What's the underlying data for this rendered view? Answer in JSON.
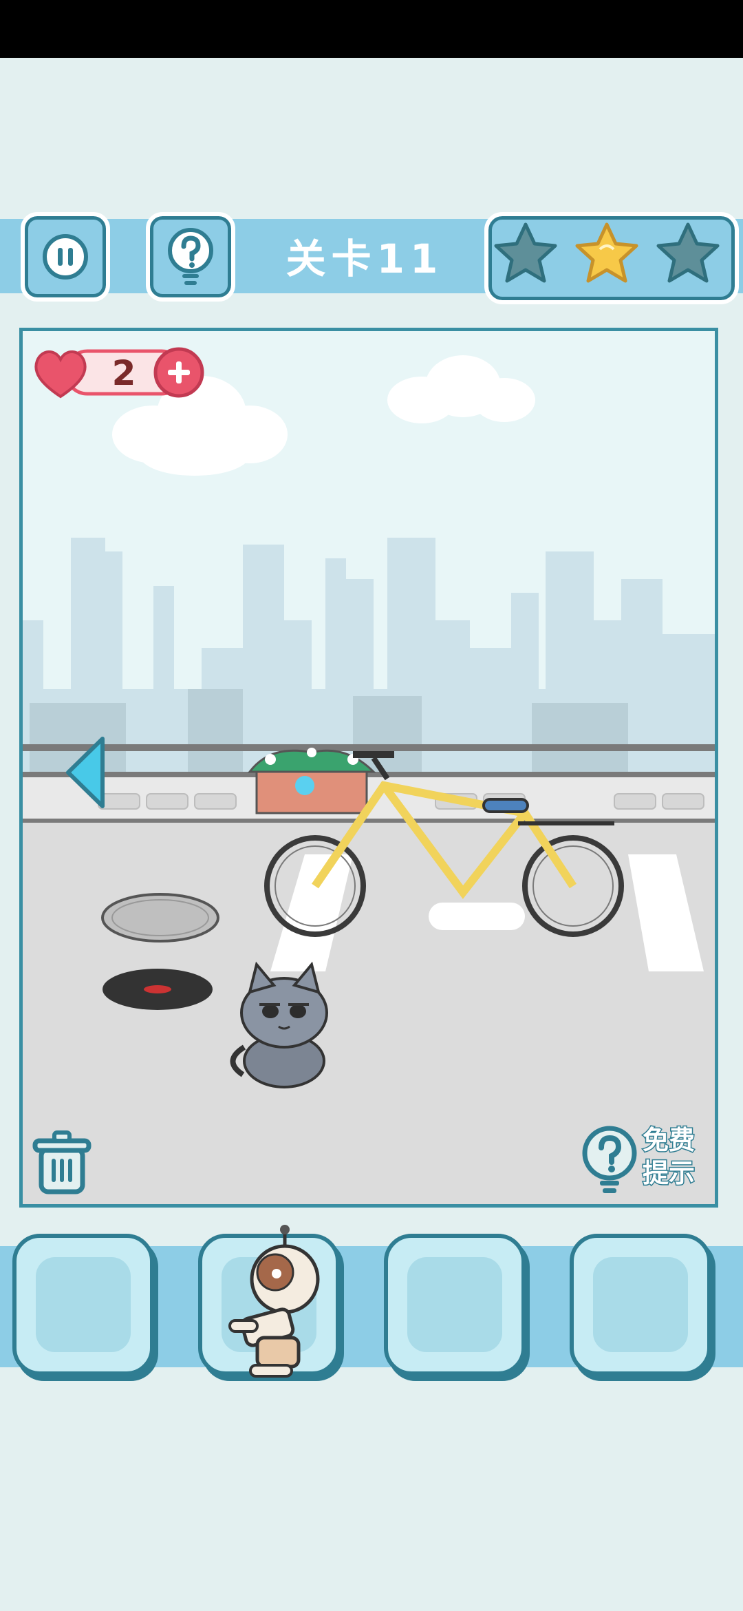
{
  "header": {
    "level_title": "关卡11",
    "stars": [
      {
        "name": "star-1",
        "earned": false
      },
      {
        "name": "star-2",
        "earned": true
      },
      {
        "name": "star-3",
        "earned": false
      }
    ],
    "pause_icon": "pause-icon",
    "help_icon": "question-bulb-icon"
  },
  "game": {
    "lives_count": "2",
    "lives_icon": "heart-icon",
    "add_lives_icon": "plus-icon",
    "back_arrow_icon": "left-arrow-icon",
    "trash_icon": "trash-icon",
    "free_hint_label_line1": "免费",
    "free_hint_label_line2": "提示",
    "scene_objects": [
      "cloud",
      "cloud",
      "city-skyline",
      "flower-planter",
      "bicycle",
      "manhole-cover",
      "open-manhole",
      "gray-cat"
    ]
  },
  "inventory": {
    "slots": [
      {
        "item": ""
      },
      {
        "item": "robot-toy"
      },
      {
        "item": ""
      },
      {
        "item": ""
      }
    ]
  },
  "colors": {
    "accent": "#8dcde6",
    "border": "#2f7d92",
    "heart": "#e9546b",
    "star_earned": "#f7c948",
    "star_empty": "#5e8f99"
  }
}
